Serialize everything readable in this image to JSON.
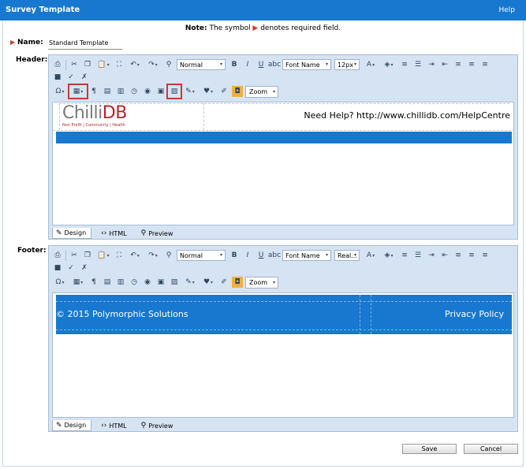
{
  "window": {
    "title": "Survey Template",
    "help_label": "Help"
  },
  "note": {
    "prefix": "Note:",
    "text_before": " The symbol ",
    "arrow": "▶",
    "text_after": " denotes required field."
  },
  "fields": {
    "name_label": "Name:",
    "name_value": "Standard Template",
    "header_label": "Header:",
    "footer_label": "Footer:"
  },
  "toolbar": {
    "paragraph_style": "Normal",
    "font_name": "Font Name",
    "header_font_size": "12px",
    "footer_font_size": "Real...",
    "zoom": "Zoom"
  },
  "header_content": {
    "logo_text_main": "Chilli",
    "logo_text_accent": "DB",
    "logo_tagline": "Non Profit | Community | Health",
    "help_text": "Need Help? http://www.chillidb.com/HelpCentre"
  },
  "footer_content": {
    "left_text": "© 2015 Polymorphic Solutions",
    "right_text": "Privacy Policy"
  },
  "tabs": {
    "design": "Design",
    "html": "HTML",
    "preview": "Preview"
  },
  "buttons": {
    "save": "Save",
    "cancel": "Cancel"
  },
  "colors": {
    "accent": "#1878cf",
    "required": "#d03a2a",
    "toolbar_bg": "#d5e3f3"
  }
}
